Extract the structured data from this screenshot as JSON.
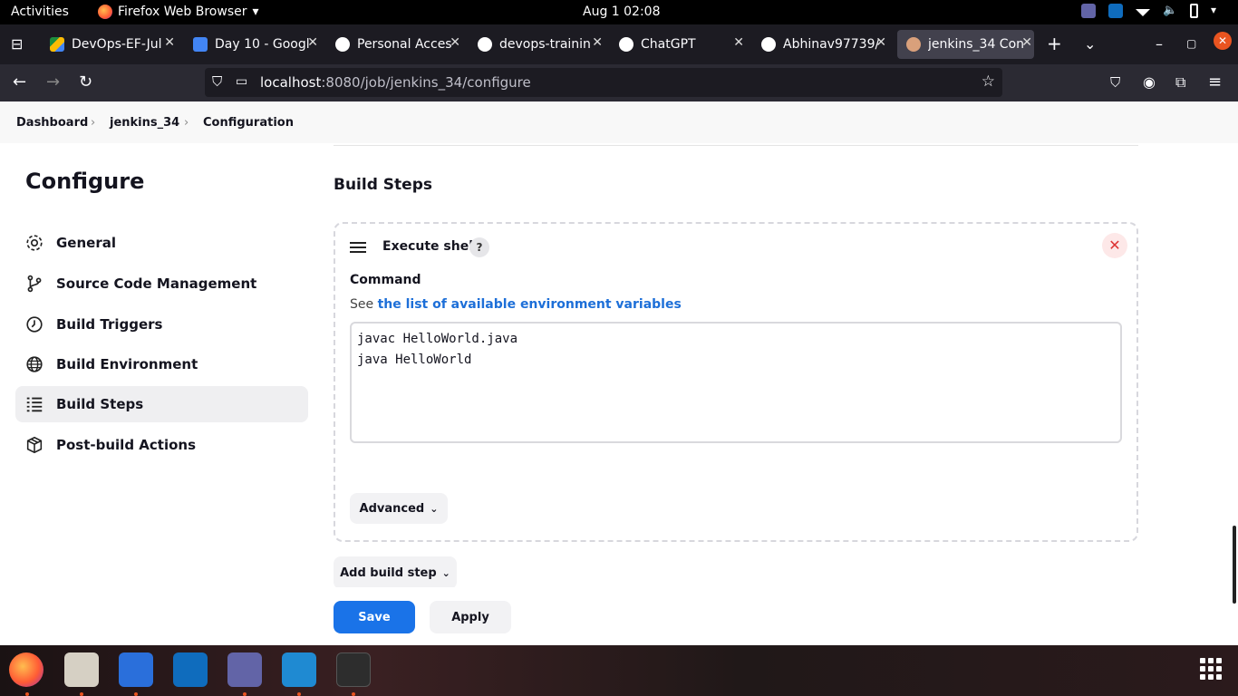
{
  "topbar": {
    "activities": "Activities",
    "app_name": "Firefox Web Browser",
    "clock": "Aug 1  02:08"
  },
  "tabs": [
    {
      "title": "DevOps-EF-Jul",
      "color": "#1e8e3e"
    },
    {
      "title": "Day 10 - Googl",
      "color": "#4285f4"
    },
    {
      "title": "Personal Acces",
      "color": "#ffffff"
    },
    {
      "title": "devops-trainin",
      "color": "#ffffff"
    },
    {
      "title": "ChatGPT",
      "color": "#ffffff"
    },
    {
      "title": "Abhinav97739/",
      "color": "#ffffff"
    },
    {
      "title": "jenkins_34 Con",
      "color": "#d9a07b",
      "active": true
    }
  ],
  "url": {
    "host": "localhost",
    "path": ":8080/job/jenkins_34/configure"
  },
  "breadcrumb": [
    "Dashboard",
    "jenkins_34",
    "Configuration"
  ],
  "sidebar": {
    "title": "Configure",
    "items": [
      {
        "label": "General",
        "icon": "gear-icon"
      },
      {
        "label": "Source Code Management",
        "icon": "branch-icon"
      },
      {
        "label": "Build Triggers",
        "icon": "clock-icon"
      },
      {
        "label": "Build Environment",
        "icon": "globe-icon"
      },
      {
        "label": "Build Steps",
        "icon": "list-icon",
        "active": true
      },
      {
        "label": "Post-build Actions",
        "icon": "package-icon"
      }
    ]
  },
  "main": {
    "section_title": "Build Steps",
    "step": {
      "title": "Execute shell",
      "help": "?",
      "command_label": "Command",
      "see_prefix": "See",
      "see_link": "the list of available environment variables",
      "command_lines": [
        "javac HelloWorld.java",
        "java HelloWorld"
      ],
      "advanced_label": "Advanced"
    },
    "add_step_label": "Add build step",
    "save_label": "Save",
    "apply_label": "Apply"
  },
  "colors": {
    "primary": "#1a73e8",
    "danger": "#d33333"
  }
}
